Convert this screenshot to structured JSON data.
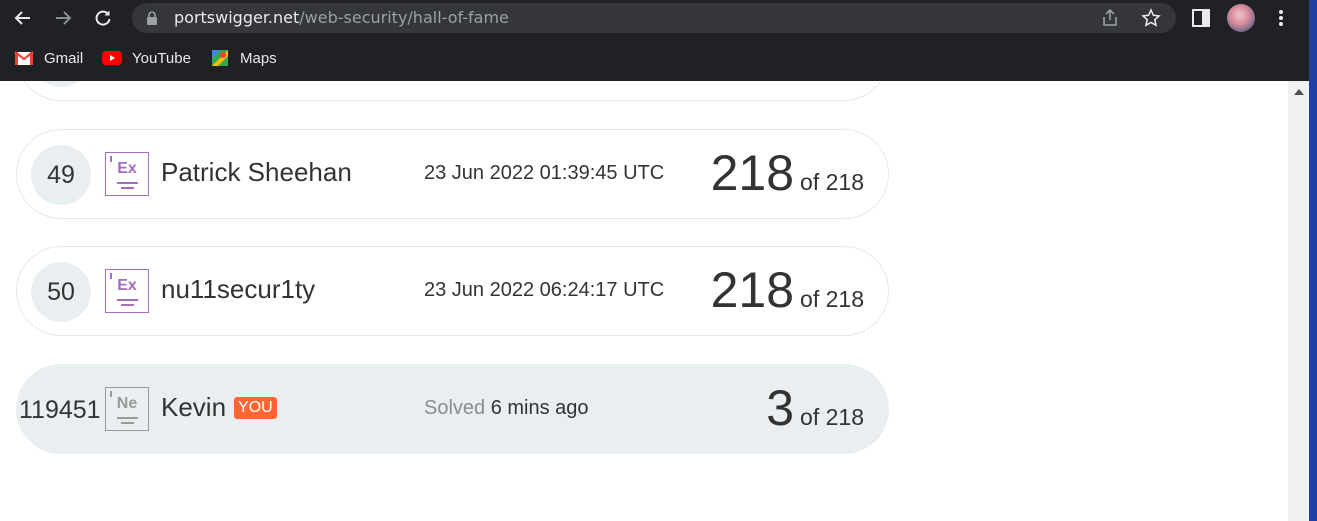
{
  "browser": {
    "url_host": "portswigger.net",
    "url_path": "/web-security/hall-of-fame",
    "bookmarks": [
      {
        "label": "Gmail",
        "icon": "gmail-icon"
      },
      {
        "label": "YouTube",
        "icon": "youtube-icon"
      },
      {
        "label": "Maps",
        "icon": "maps-icon"
      }
    ]
  },
  "leaderboard": {
    "rows": [
      {
        "rank": "49",
        "badge": "Ex",
        "name": "Patrick Sheehan",
        "time": "23 Jun 2022 01:39:45 UTC",
        "score": "218",
        "of": "of 218"
      },
      {
        "rank": "50",
        "badge": "Ex",
        "name": "nu11secur1ty",
        "time": "23 Jun 2022 06:24:17 UTC",
        "score": "218",
        "of": "of 218"
      }
    ],
    "you": {
      "rank": "119451",
      "badge": "Ne",
      "name": "Kevin",
      "tag": "YOU",
      "solved_label": "Solved",
      "solved_time": "6 mins ago",
      "score": "3",
      "of": "of 218"
    }
  },
  "colors": {
    "expert_badge": "#a56cbf",
    "newbie_badge": "#9a9a9a",
    "you_tag": "#ff6633",
    "highlight_row": "#e9eef1"
  }
}
